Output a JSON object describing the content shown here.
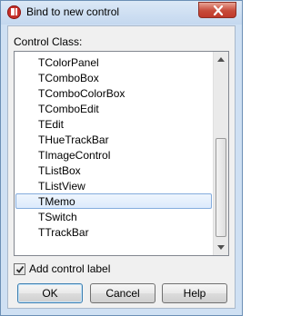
{
  "window": {
    "title": "Bind to new control",
    "close_icon": "close-icon",
    "app_icon": "app-icon"
  },
  "control_class": {
    "label": "Control Class:",
    "items": [
      "TColorPanel",
      "TComboBox",
      "TComboColorBox",
      "TComboEdit",
      "TEdit",
      "THueTrackBar",
      "TImageControl",
      "TListBox",
      "TListView",
      "TMemo",
      "TSwitch",
      "TTrackBar"
    ],
    "selected": "TMemo"
  },
  "add_label": {
    "text": "Add control label",
    "checked": true
  },
  "buttons": {
    "ok": "OK",
    "cancel": "Cancel",
    "help": "Help"
  },
  "colors": {
    "selection_border": "#84acdd",
    "title_bar": "#c4d8ef",
    "close_button": "#c74b3a"
  }
}
